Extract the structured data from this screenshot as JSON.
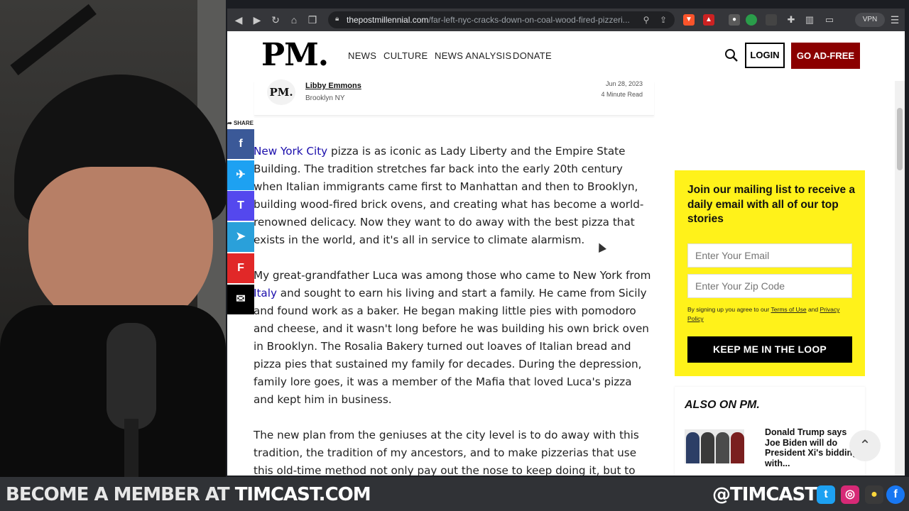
{
  "stream": {
    "banner_prefix": "BECOME A MEMBER AT",
    "banner_site": "TIMCAST.COM",
    "handle": "@TIMCAST",
    "social_icons": [
      "twitter-icon",
      "instagram-icon",
      "lightbulb-icon",
      "facebook-icon"
    ]
  },
  "browser": {
    "url_domain": "thepostmillennial.com",
    "url_path": "/far-left-nyc-cracks-down-on-coal-wood-fired-pizzeri...",
    "vpn_label": "VPN"
  },
  "site": {
    "logo": "PM.",
    "nav": [
      "NEWS",
      "CULTURE",
      "NEWS ANALYSIS",
      "DONATE"
    ],
    "login": "LOGIN",
    "ad_free": "GO AD-FREE"
  },
  "byline": {
    "avatar": "PM.",
    "author": "Libby Emmons",
    "location": "Brooklyn NY",
    "date": "Jun 28, 2023",
    "read_time": "4 Minute Read"
  },
  "share": {
    "label": "SHARE",
    "buttons": [
      {
        "name": "facebook",
        "glyph": "f",
        "color": "#3b5998"
      },
      {
        "name": "twitter",
        "glyph": "✈",
        "color": "#1da1f2"
      },
      {
        "name": "truth-social",
        "glyph": "T",
        "color": "#5448ee"
      },
      {
        "name": "telegram",
        "glyph": "➤",
        "color": "#2aa0da"
      },
      {
        "name": "flipboard",
        "glyph": "F",
        "color": "#e12828"
      },
      {
        "name": "email",
        "glyph": "✉",
        "color": "#000000"
      }
    ]
  },
  "article": {
    "p1_link": "New York City",
    "p1_text": " pizza is as iconic as Lady Liberty and the Empire State Building. The tradition stretches far back into the early 20th century when Italian immigrants came first to Manhattan and then to Brooklyn, building wood-fired brick ovens, and creating what has become a world-renowned delicacy. Now they want to do away with the best pizza that exists in the world, and it's all in service to climate alarmism.",
    "p2_before": "My great-grandfather Luca was among those who came to New York from ",
    "p2_link": "Italy",
    "p2_after": " and sought to earn his living and start a family. He came from Sicily and found work as a baker. He began making little pies with pomodoro and cheese, and it wasn't long before he was building his own brick oven in Brooklyn. The Rosalia Bakery turned out loaves of Italian bread and pizza pies that sustained my family for decades. During the depression, family lore goes, it was a member of the Mafia that loved Luca's pizza and kept him in business.",
    "p3_text": "The new plan from the geniuses at the city level is to do away with this tradition, the tradition of my ancestors, and to make pizzerias that use this old-time method not only pay out the nose to keep doing it, but to"
  },
  "newsletter": {
    "heading": "Join our mailing list to receive a daily email with all of our top stories",
    "email_placeholder": "Enter Your Email",
    "zip_placeholder": "Enter Your Zip Code",
    "terms_prefix": "By signing up you agree to our ",
    "terms_link": "Terms of Use",
    "terms_mid": " and ",
    "privacy_link": "Privacy Policy",
    "button": "KEEP ME IN THE LOOP"
  },
  "also_on": {
    "heading": "ALSO ON PM.",
    "headline": "Donald Trump says Joe Biden will do President Xi's bidding with..."
  },
  "colors": {
    "brand_red": "#8b0000",
    "newsletter_yellow": "#fff21a",
    "link_blue": "#1a0dab"
  }
}
